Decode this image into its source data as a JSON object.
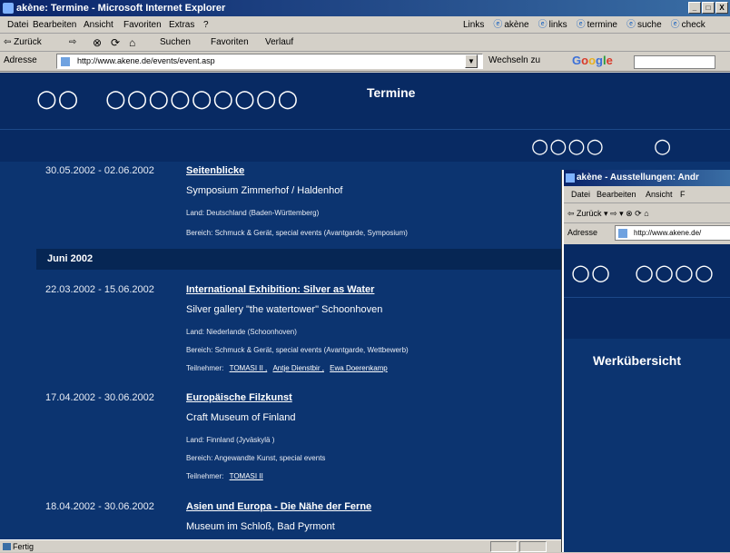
{
  "main_window": {
    "title": "akène: Termine - Microsoft Internet Explorer",
    "title_buttons": [
      "_",
      "□",
      "X"
    ],
    "menu": [
      "Datei",
      "Bearbeiten",
      "Ansicht",
      "Favoriten",
      "Extras",
      "?"
    ],
    "links_label": "Links",
    "links": [
      "akène",
      "links",
      "termine",
      "suche",
      "check"
    ],
    "toolbar": {
      "back": "⇦ Zurück",
      "forward": "⇨",
      "stop": "⊗",
      "refresh": "⟳",
      "home": "⌂",
      "search": "Suchen",
      "favorites": "Favoriten",
      "history": "Verlauf"
    },
    "address_label": "Adresse",
    "address_url": "http://www.akene.de/events/event.asp",
    "go_label": "Wechseln zu",
    "google_letters": [
      "G",
      "o",
      "o",
      "g",
      "l",
      "e"
    ],
    "status_text": "Fertig"
  },
  "site": {
    "logo_circles": "○○",
    "nav_circles": "○○○○○○○○○",
    "page_title": "Termine",
    "nav_right_1": "○○○○",
    "nav_right_2": "○"
  },
  "events_before": [
    {
      "date": "30.05.2002 - 02.06.2002",
      "title": "Seitenblicke",
      "venue": "Symposium Zimmerhof / Haldenhof",
      "land": "Land: Deutschland (Baden-Württemberg)",
      "bereich": "Bereich: Schmuck & Gerät, special events   (Avantgarde, Symposium)",
      "teilnehmer_label": "",
      "teilnehmer": []
    }
  ],
  "month_header": "Juni 2002",
  "events": [
    {
      "date": "22.03.2002 - 15.06.2002",
      "title": "International Exhibition: Silver as Water",
      "venue": "Silver gallery \"the watertower\" Schoonhoven",
      "land": "Land: Niederlande (Schoonhoven)",
      "bereich": "Bereich: Schmuck & Gerät, special events   (Avantgarde, Wettbewerb)",
      "teilnehmer_label": "Teilnehmer:",
      "teilnehmer": [
        "TOMASI II ,",
        "Antje Dienstbir ,",
        "Ewa Doerenkamp"
      ]
    },
    {
      "date": "17.04.2002 - 30.06.2002",
      "title": "Europäische Filzkunst",
      "venue": "Craft Museum of Finland",
      "land": "Land: Finnland (Jyväskylä )",
      "bereich": "Bereich: Angewandte Kunst, special events",
      "teilnehmer_label": "Teilnehmer:",
      "teilnehmer": [
        "TOMASI II"
      ]
    },
    {
      "date": "18.04.2002 - 30.06.2002",
      "title": "Asien und Europa - Die Nähe der Ferne",
      "venue": "Museum im Schloß, Bad Pyrmont",
      "land": "",
      "bereich": "",
      "teilnehmer_label": "",
      "teilnehmer": []
    }
  ],
  "second_window": {
    "title": "akène - Ausstellungen: Andr",
    "menu": [
      "Datei",
      "Bearbeiten",
      "Ansicht",
      "F"
    ],
    "toolbar": "⇦ Zurück  ▾  ⇨  ▾   ⊗   ⟳   ⌂",
    "address_label": "Adresse",
    "address_url": "http://www.akene.de/",
    "logo_circles": "○○",
    "nav_circles": "○○○○",
    "heading": "Werkübersicht"
  },
  "colors": {
    "page_bg": "#0c3470",
    "header_bg": "#082a63",
    "month_bg": "#062654",
    "titlebar_start": "#0a246a",
    "titlebar_end": "#3a6ea5",
    "chrome": "#d4d0c8"
  }
}
